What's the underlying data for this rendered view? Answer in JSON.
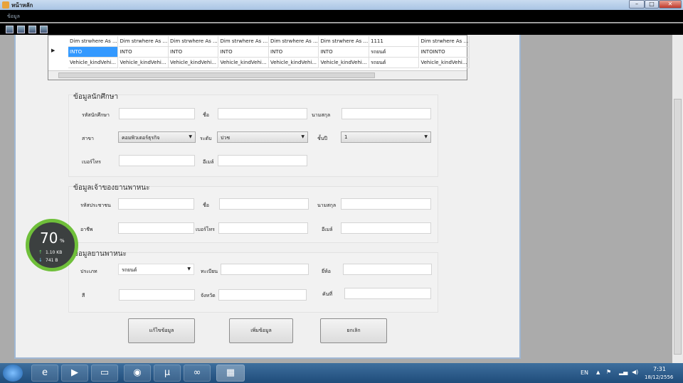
{
  "window": {
    "title": "หน้าหลัก",
    "minimize": "–",
    "maximize": "□",
    "close": "✕"
  },
  "menu": {
    "item": "ข้อมูล"
  },
  "toolbar": {
    "icons": [
      "image-icon",
      "image-icon",
      "image-icon",
      "image-icon"
    ]
  },
  "grid": {
    "rows": [
      [
        "Dim strwhere As ...",
        "Dim strwhere As ...",
        "Dim strwhere As ...",
        "Dim strwhere As ...",
        "Dim strwhere As ...",
        "Dim strwhere As ...",
        "1111",
        "Dim strwhere As ..."
      ],
      [
        "INTO",
        "INTO",
        "INTO",
        "INTO",
        "INTO",
        "INTO",
        "รถยนต์",
        "INTOINTO"
      ],
      [
        "Vehicle_kindVehi...",
        "Vehicle_kindVehi...",
        "Vehicle_kindVehi...",
        "Vehicle_kindVehi...",
        "Vehicle_kindVehi...",
        "Vehicle_kindVehi...",
        "รถยนต์",
        "Vehicle_kindVehi..."
      ]
    ]
  },
  "student": {
    "title": "ข้อมูลนักศึกษา",
    "id": "รหัสนักศึกษา",
    "name": "ชื่อ",
    "surname": "นามสกุล",
    "branch": "สาขา",
    "branch_value": "คอมพิวเตอร์ธุรกิจ",
    "level": "ระดับ",
    "level_value": "ปวช",
    "year": "ชั้นปี",
    "year_value": "1",
    "phone": "เบอร์โทร",
    "email": "อีเมล์"
  },
  "owner": {
    "title": "ข้อมูลเจ้าของยานพาหนะ",
    "citizen_id": "รหัสประชาชน",
    "name": "ชื่อ",
    "surname": "นามสกุล",
    "job": "อาชีพ",
    "phone": "เบอร์โทร",
    "email": "อีเมล์"
  },
  "vehicle": {
    "title": "ข้อมูลยานพาหนะ",
    "type": "ประเภท",
    "type_value": "รถยนต์",
    "plate": "ทะเบียน",
    "brand": "ยี่ห้อ",
    "color": "สี",
    "province": "จังหวัด",
    "number": "คันที่"
  },
  "buttons": {
    "edit": "แก้ไขข้อมูล",
    "add": "เพิ่มข้อมูล",
    "cancel": "ยกเลิก"
  },
  "gauge": {
    "percent": "70",
    "unit": "%",
    "upload": "1.10 KB",
    "download": "741 B",
    "accent": "#6fbf3a"
  },
  "taskbar": {
    "lang": "EN",
    "time": "7:31",
    "date": "18/12/2556"
  }
}
